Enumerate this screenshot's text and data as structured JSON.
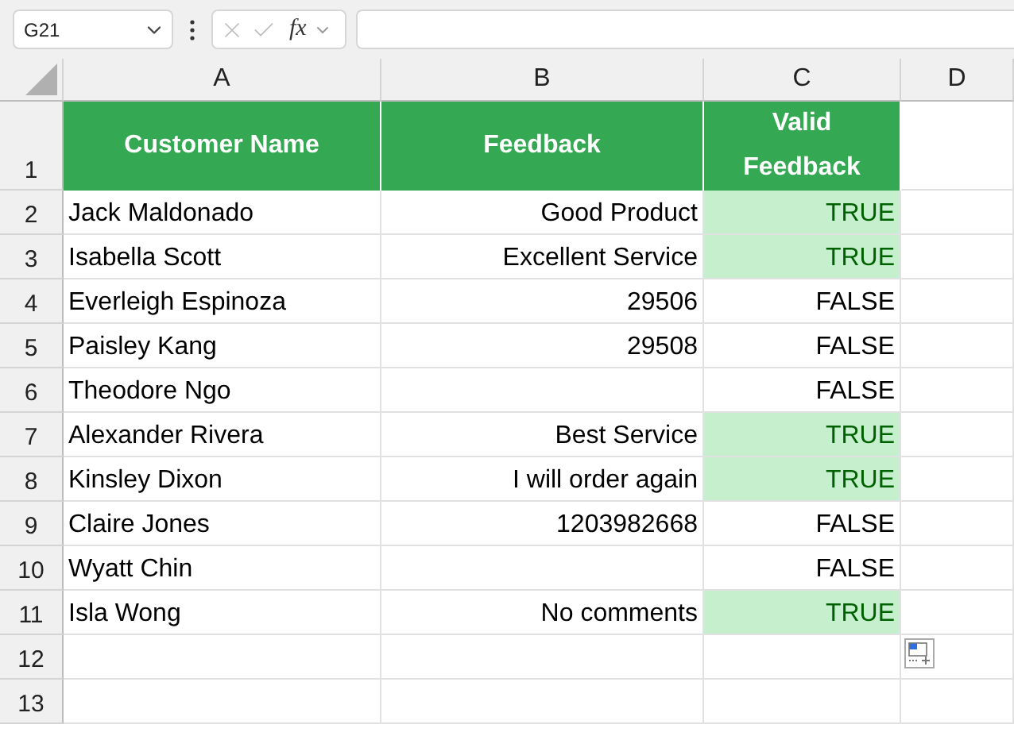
{
  "formula_bar": {
    "name_box": "G21",
    "function_label": "fx"
  },
  "columns": [
    "A",
    "B",
    "C",
    "D"
  ],
  "header_row": {
    "number": "1",
    "cells": [
      "Customer Name",
      "Feedback",
      "Valid Feedback"
    ]
  },
  "rows": [
    {
      "number": "2",
      "name": "Jack Maldonado",
      "feedback": "Good Product",
      "valid": "TRUE",
      "highlighted": true
    },
    {
      "number": "3",
      "name": "Isabella Scott",
      "feedback": "Excellent Service",
      "valid": "TRUE",
      "highlighted": true
    },
    {
      "number": "4",
      "name": "Everleigh Espinoza",
      "feedback": "29506",
      "valid": "FALSE",
      "highlighted": false
    },
    {
      "number": "5",
      "name": "Paisley Kang",
      "feedback": "29508",
      "valid": "FALSE",
      "highlighted": false
    },
    {
      "number": "6",
      "name": "Theodore Ngo",
      "feedback": "",
      "valid": "FALSE",
      "highlighted": false
    },
    {
      "number": "7",
      "name": "Alexander Rivera",
      "feedback": "Best Service",
      "valid": "TRUE",
      "highlighted": true
    },
    {
      "number": "8",
      "name": "Kinsley Dixon",
      "feedback": "I will order again",
      "valid": "TRUE",
      "highlighted": true
    },
    {
      "number": "9",
      "name": "Claire Jones",
      "feedback": "1203982668",
      "valid": "FALSE",
      "highlighted": false
    },
    {
      "number": "10",
      "name": "Wyatt Chin",
      "feedback": "",
      "valid": "FALSE",
      "highlighted": false
    },
    {
      "number": "11",
      "name": "Isla Wong",
      "feedback": "No comments",
      "valid": "TRUE",
      "highlighted": true
    }
  ],
  "empty_rows": [
    "12",
    "13"
  ]
}
